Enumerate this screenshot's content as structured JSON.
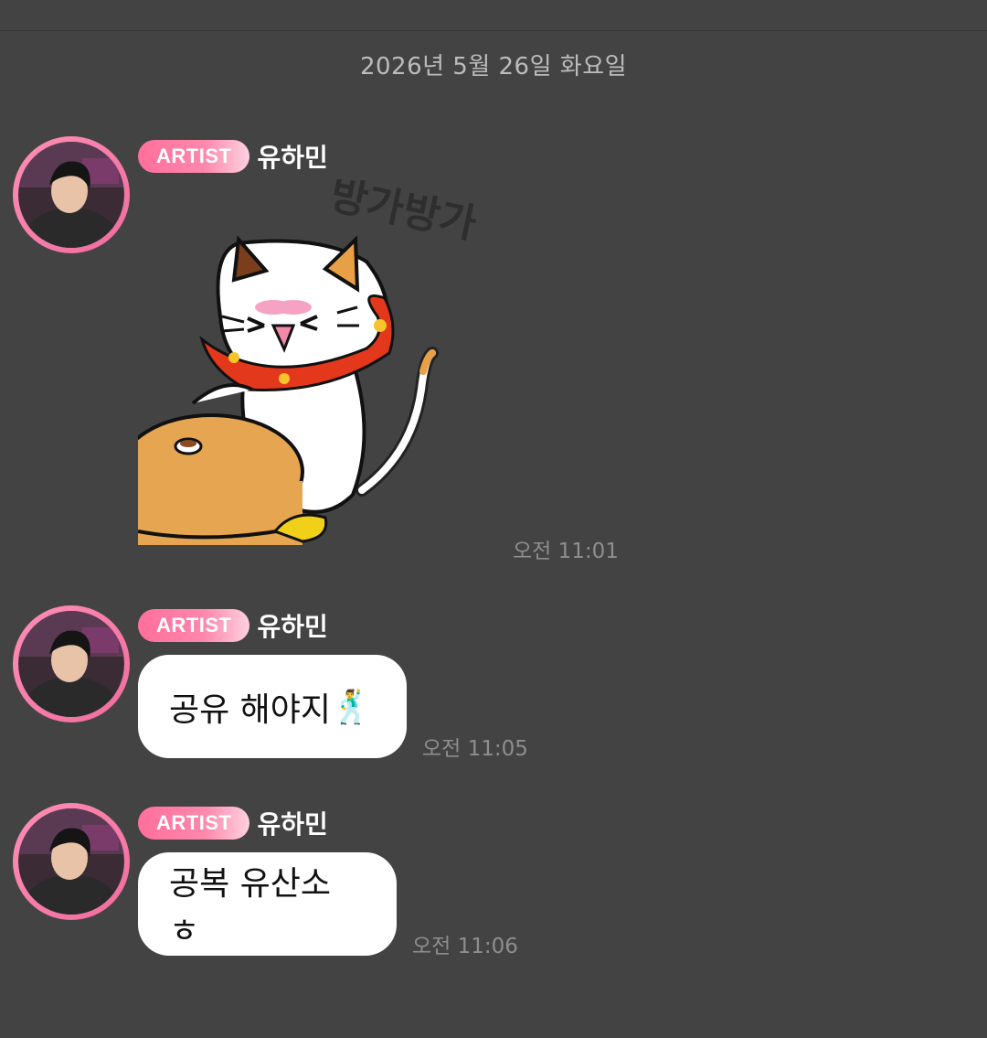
{
  "date_separator": "2026년 5월 26일 화요일",
  "badge_label": "ARTIST",
  "messages": [
    {
      "sender": "유하민",
      "type": "sticker",
      "sticker_text": "방가방가",
      "time": "오전 11:01"
    },
    {
      "sender": "유하민",
      "type": "text",
      "text": "공유 해야지",
      "emoji": "🕺",
      "time": "오전 11:05"
    },
    {
      "sender": "유하민",
      "type": "text",
      "text": "공복 유산소 ㅎ",
      "time": "오전 11:06"
    }
  ],
  "colors": {
    "background": "#434343",
    "badge": "#ff6f9b",
    "bubble": "#ffffff",
    "avatar_ring": "#f06b9d"
  }
}
